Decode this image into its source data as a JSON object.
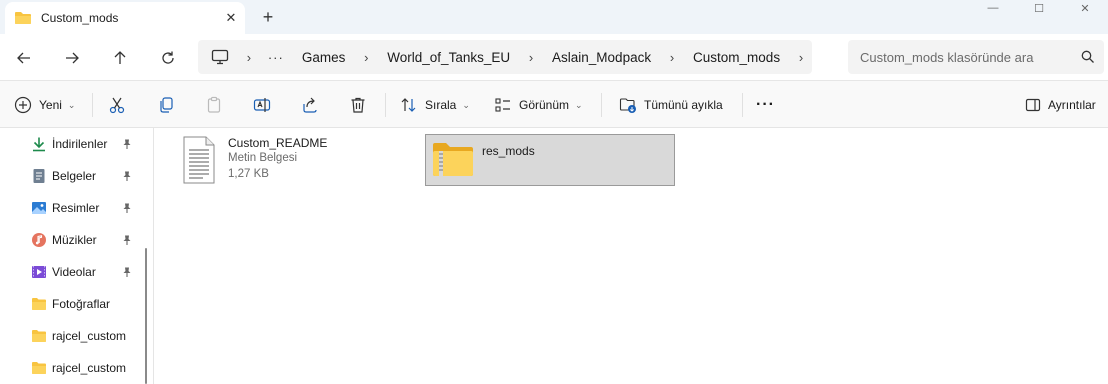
{
  "tab": {
    "title": "Custom_mods",
    "close_glyph": "✕",
    "new_tab_glyph": "+"
  },
  "window_controls": {
    "minimize_glyph": "—",
    "maximize_glyph": "☐",
    "close_glyph": "✕"
  },
  "address_bar": {
    "more": "···",
    "separator": "›",
    "crumbs": [
      "Games",
      "World_of_Tanks_EU",
      "Aslain_Modpack",
      "Custom_mods"
    ]
  },
  "search": {
    "placeholder": "Custom_mods klasöründe ara"
  },
  "commands": {
    "new_label": "Yeni",
    "sort_label": "Sırala",
    "view_label": "Görünüm",
    "select_all_label": "Tümünü ayıkla",
    "more": "···",
    "details_label": "Ayrıntılar",
    "chevron": "⌄"
  },
  "sidebar": {
    "items": [
      {
        "label": "İndirilenler",
        "icon": "download-icon",
        "pinned": true
      },
      {
        "label": "Belgeler",
        "icon": "documents-icon",
        "pinned": true
      },
      {
        "label": "Resimler",
        "icon": "pictures-icon",
        "pinned": true
      },
      {
        "label": "Müzikler",
        "icon": "music-icon",
        "pinned": true
      },
      {
        "label": "Videolar",
        "icon": "videos-icon",
        "pinned": true
      },
      {
        "label": "Fotoğraflar",
        "icon": "folder-icon",
        "pinned": false
      },
      {
        "label": "rajcel_custom",
        "icon": "folder-icon",
        "pinned": false
      },
      {
        "label": "rajcel_custom",
        "icon": "folder-icon",
        "pinned": false
      }
    ]
  },
  "files": [
    {
      "name": "Custom_README",
      "type": "Metin Belgesi",
      "size": "1,27 KB",
      "icon": "text-document-icon",
      "selected": false
    },
    {
      "name": "res_mods",
      "icon": "zip-folder-icon",
      "selected": true
    }
  ],
  "colors": {
    "accent": "#0067c0",
    "folder_yellow": "#f8c440",
    "selection": "#d9d9d9"
  }
}
